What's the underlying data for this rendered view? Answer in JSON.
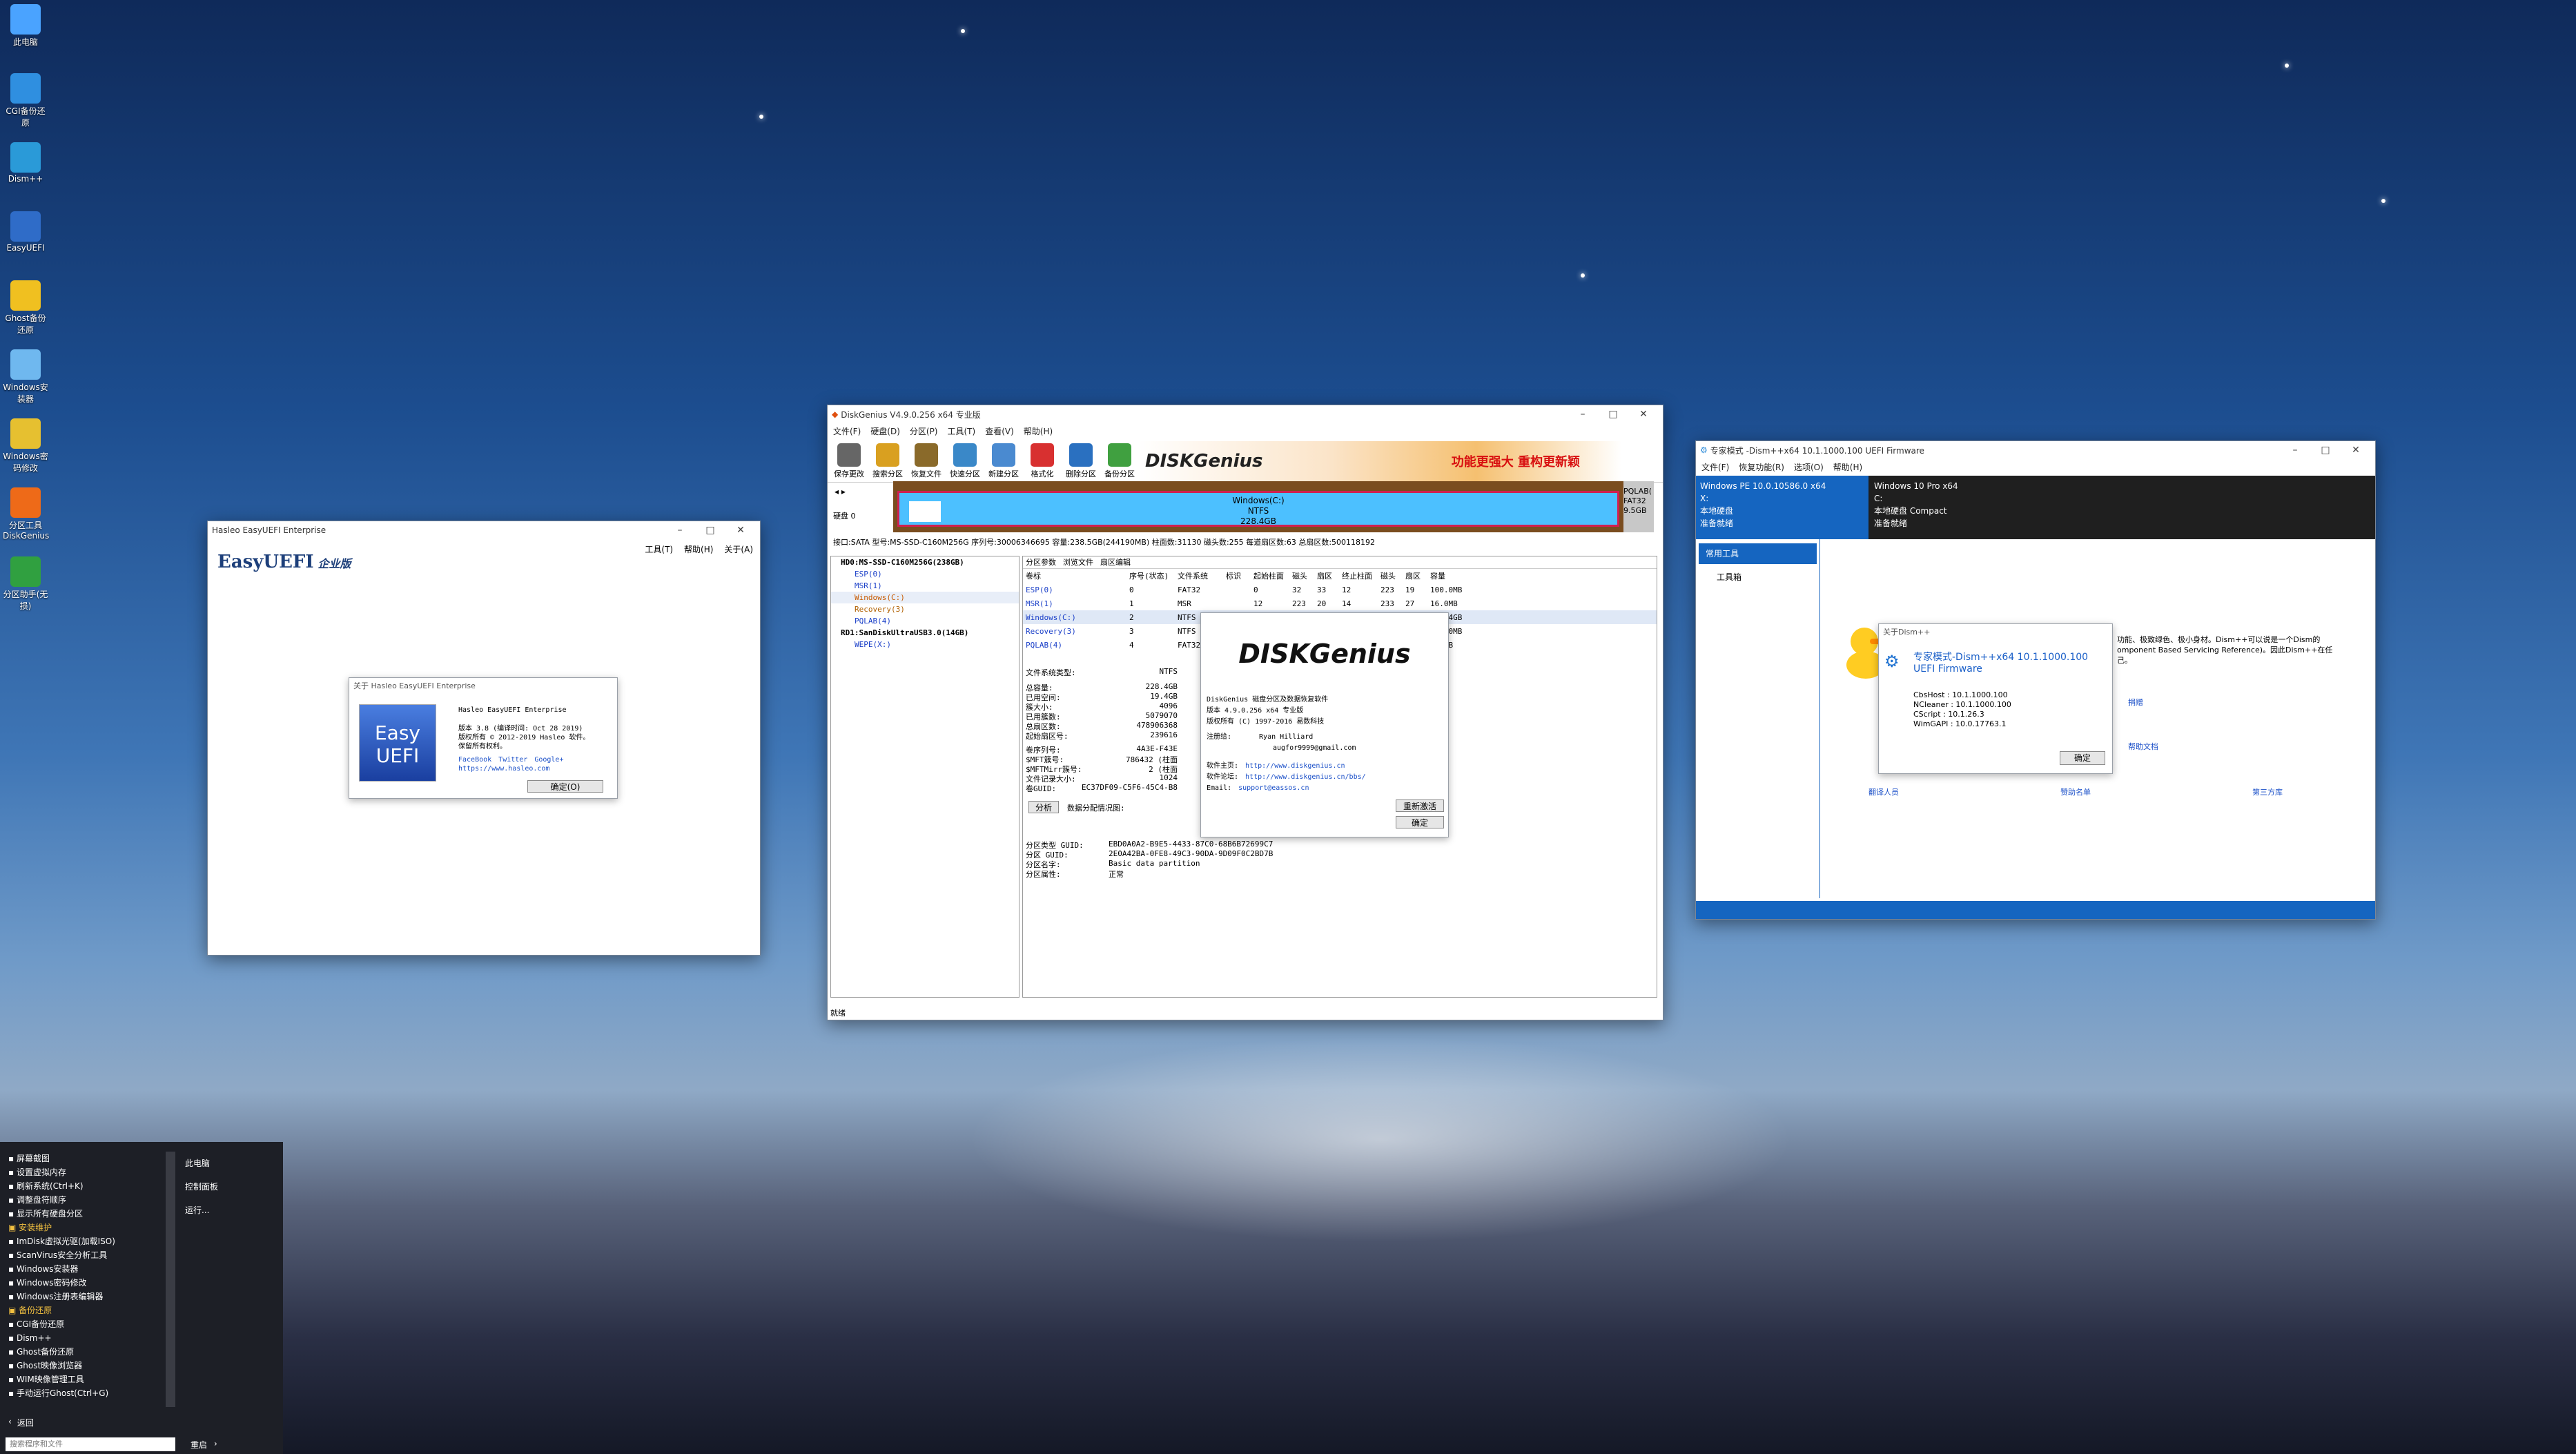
{
  "desktop": {
    "icons": [
      {
        "label": "此电脑",
        "color": "#4aa3ff"
      },
      {
        "label": "CGI备份还原",
        "color": "#2f8fe0"
      },
      {
        "label": "Dism++",
        "color": "#2a9ad8"
      },
      {
        "label": "EasyUEFI",
        "color": "#2f6cc8"
      },
      {
        "label": "Ghost备份还原",
        "color": "#f0c020"
      },
      {
        "label": "Windows安装器",
        "color": "#6fb8ef"
      },
      {
        "label": "Windows密码修改",
        "color": "#e6c030"
      },
      {
        "label": "分区工具DiskGenius",
        "color": "#ee6a18"
      },
      {
        "label": "分区助手(无损)",
        "color": "#30a040"
      }
    ]
  },
  "easyuefi": {
    "title": "Hasleo EasyUEFI Enterprise",
    "menu": [
      "工具(T)",
      "帮助(H)",
      "关于(A)"
    ],
    "logo": "EasyUEFI",
    "edition": "企业版",
    "about": {
      "title": "关于 Hasleo EasyUEFI Enterprise",
      "product": "Hasleo EasyUEFI Enterprise",
      "version": "版本 3.8 (编译时间: Oct 28 2019)",
      "copyright": "版权所有 © 2012-2019 Hasleo 软件。",
      "rights": "保留所有权利。",
      "links": [
        "FaceBook",
        "Twitter",
        "Google+"
      ],
      "url": "https://www.hasleo.com",
      "ok": "确定(O)"
    }
  },
  "diskgenius": {
    "title": "DiskGenius V4.9.0.256 x64 专业版",
    "menu": [
      "文件(F)",
      "硬盘(D)",
      "分区(P)",
      "工具(T)",
      "查看(V)",
      "帮助(H)"
    ],
    "toolbar": [
      {
        "label": "保存更改",
        "color": "#666"
      },
      {
        "label": "搜索分区",
        "color": "#d9a020"
      },
      {
        "label": "恢复文件",
        "color": "#8a6a2a"
      },
      {
        "label": "快速分区",
        "color": "#3a88c8"
      },
      {
        "label": "新建分区",
        "color": "#4a8ad0"
      },
      {
        "label": "格式化",
        "color": "#d83030"
      },
      {
        "label": "删除分区",
        "color": "#2a70c0"
      },
      {
        "label": "备份分区",
        "color": "#40a040"
      }
    ],
    "banner": "功能更强大  重构更新颖",
    "disk_label": "硬盘 0",
    "partition_main": {
      "name": "Windows(C:)",
      "fs": "NTFS",
      "size": "228.4GB"
    },
    "partition_tail": {
      "name": "PQLAB(",
      "fs": "FAT32",
      "size": "9.5GB"
    },
    "disk_info": "接口:SATA  型号:MS-SSD-C160M256G  序列号:30006346695  容量:238.5GB(244190MB)  柱面数:31130  磁头数:255  每道扇区数:63  总扇区数:500118192",
    "tree": [
      "HD0:MS-SSD-C160M256G(238GB)",
      "ESP(0)",
      "MSR(1)",
      "Windows(C:)",
      "Recovery(3)",
      "PQLAB(4)",
      "RD1:SanDiskUltraUSB3.0(14GB)",
      "WEPE(X:)"
    ],
    "tabs": [
      "分区参数",
      "浏览文件",
      "扇区编辑"
    ],
    "columns": [
      "卷标",
      "序号(状态)",
      "文件系统",
      "标识",
      "起始柱面",
      "磁头",
      "扇区",
      "终止柱面",
      "磁头",
      "扇区",
      "容量"
    ],
    "rows": [
      [
        "ESP(0)",
        "0",
        "FAT32",
        "",
        "0",
        "32",
        "33",
        "12",
        "223",
        "19",
        "100.0MB"
      ],
      [
        "MSR(1)",
        "1",
        "MSR",
        "",
        "12",
        "223",
        "20",
        "14",
        "233",
        "27",
        "16.0MB"
      ],
      [
        "Windows(C:)",
        "2",
        "NTFS",
        "",
        "14",
        "233",
        "28",
        "29837",
        "118",
        "51",
        "228.4GB"
      ],
      [
        "Recovery(3)",
        "3",
        "NTFS",
        "",
        "",
        "",
        "",
        "",
        "",
        "",
        "500.0MB"
      ],
      [
        "PQLAB(4)",
        "4",
        "FAT32",
        "",
        "",
        "",
        "",
        "",
        "",
        "",
        "9.5GB"
      ]
    ],
    "fs_type_label": "文件系统类型:",
    "fs_type_value": "NTFS",
    "details": [
      [
        "总容量:",
        "228.4GB"
      ],
      [
        "已用空间:",
        "19.4GB"
      ],
      [
        "簇大小:",
        "4096"
      ],
      [
        "已用簇数:",
        "5079070"
      ],
      [
        "总扇区数:",
        "478906368"
      ],
      [
        "起始扇区号:",
        "239616"
      ]
    ],
    "details2": [
      [
        "卷序列号:",
        "4A3E-F43E"
      ],
      [
        "$MFT簇号:",
        "786432 (柱面"
      ],
      [
        "$MFTMirr簇号:",
        "2 (柱面"
      ],
      [
        "文件记录大小:",
        "1024"
      ],
      [
        "卷GUID:",
        "EC37DF09-C5F6-45C4-B8"
      ]
    ],
    "analyze_button": "分析",
    "analyze_label": "数据分配情况图:",
    "guid": [
      [
        "分区类型 GUID:",
        "EBD0A0A2-B9E5-4433-87C0-68B6B72699C7"
      ],
      [
        "分区 GUID:",
        "2E0A42BA-0FE8-49C3-90DA-9D09F0C2BD7B"
      ],
      [
        "分区名字:",
        "Basic data partition"
      ],
      [
        "分区属性:",
        "正常"
      ]
    ],
    "status": "就绪",
    "about": {
      "logo": "DISKGenius",
      "l1": "DiskGenius  磁盘分区及数据恢复软件",
      "l2": "版本 4.9.0.256 x64 专业版",
      "l3": "版权所有 (C) 1997-2016 易数科技",
      "author_label": "注册给:",
      "author": "Ryan Hilliard",
      "email_addr": "augfor9999@gmail.com",
      "home_label": "软件主页:",
      "home": "http://www.diskgenius.cn",
      "forum_label": "软件论坛:",
      "forum": "http://www.diskgenius.cn/bbs/",
      "mail_label": "Email:",
      "mail": "support@eassos.cn",
      "register": "重新激活",
      "ok": "确定"
    }
  },
  "dism": {
    "title": "专家模式 -Dism++x64 10.1.1000.100 UEFI Firmware",
    "menu": [
      "文件(F)",
      "恢复功能(R)",
      "选项(O)",
      "帮助(H)"
    ],
    "left_os": "Windows PE 10.0.10586.0 x64",
    "left_drive": "X:",
    "left_disk": "本地硬盘",
    "left_status": "准备就绪",
    "right_os": "Windows 10 Pro x64",
    "right_drive": "C:",
    "right_disk": "本地硬盘 Compact",
    "right_status": "准备就绪",
    "side": [
      "常用工具",
      "工具箱"
    ],
    "bg_text1": "功能、极致绿色、极小身材。Dism++可以说是一个Dism的",
    "bg_text2": "omponent Based Servicing Reference)。因此Dism++在任",
    "bg_text3": "己。",
    "bg_links": [
      "捐赠",
      "帮助文档"
    ],
    "bottom_links": [
      "翻译人员",
      "赞助名单",
      "第三方库"
    ],
    "about": {
      "title": "关于Dism++",
      "heading": "专家模式-Dism++x64 10.1.1000.100 UEFI Firmware",
      "lines": [
        "CbsHost : 10.1.1000.100",
        "NCleaner : 10.1.1000.100",
        "CScript : 10.1.26.3",
        "WimGAPI : 10.0.17763.1"
      ],
      "ok": "确定"
    }
  },
  "start_menu": {
    "items": [
      "屏幕截图",
      "设置虚拟内存",
      "刷新系统(Ctrl+K)",
      "调整盘符顺序",
      "显示所有硬盘分区",
      "安装维护",
      "ImDisk虚拟光驱(加载ISO)",
      "ScanVirus安全分析工具",
      "Windows安装器",
      "Windows密码修改",
      "Windows注册表编辑器",
      "备份还原",
      "CGI备份还原",
      "Dism++",
      "Ghost备份还原",
      "Ghost映像浏览器",
      "WIM映像管理工具",
      "手动运行Ghost(Ctrl+G)"
    ],
    "right": [
      "此电脑",
      "控制面板",
      "运行..."
    ],
    "back": "返回",
    "search_placeholder": "搜索程序和文件",
    "restart": "重启"
  }
}
